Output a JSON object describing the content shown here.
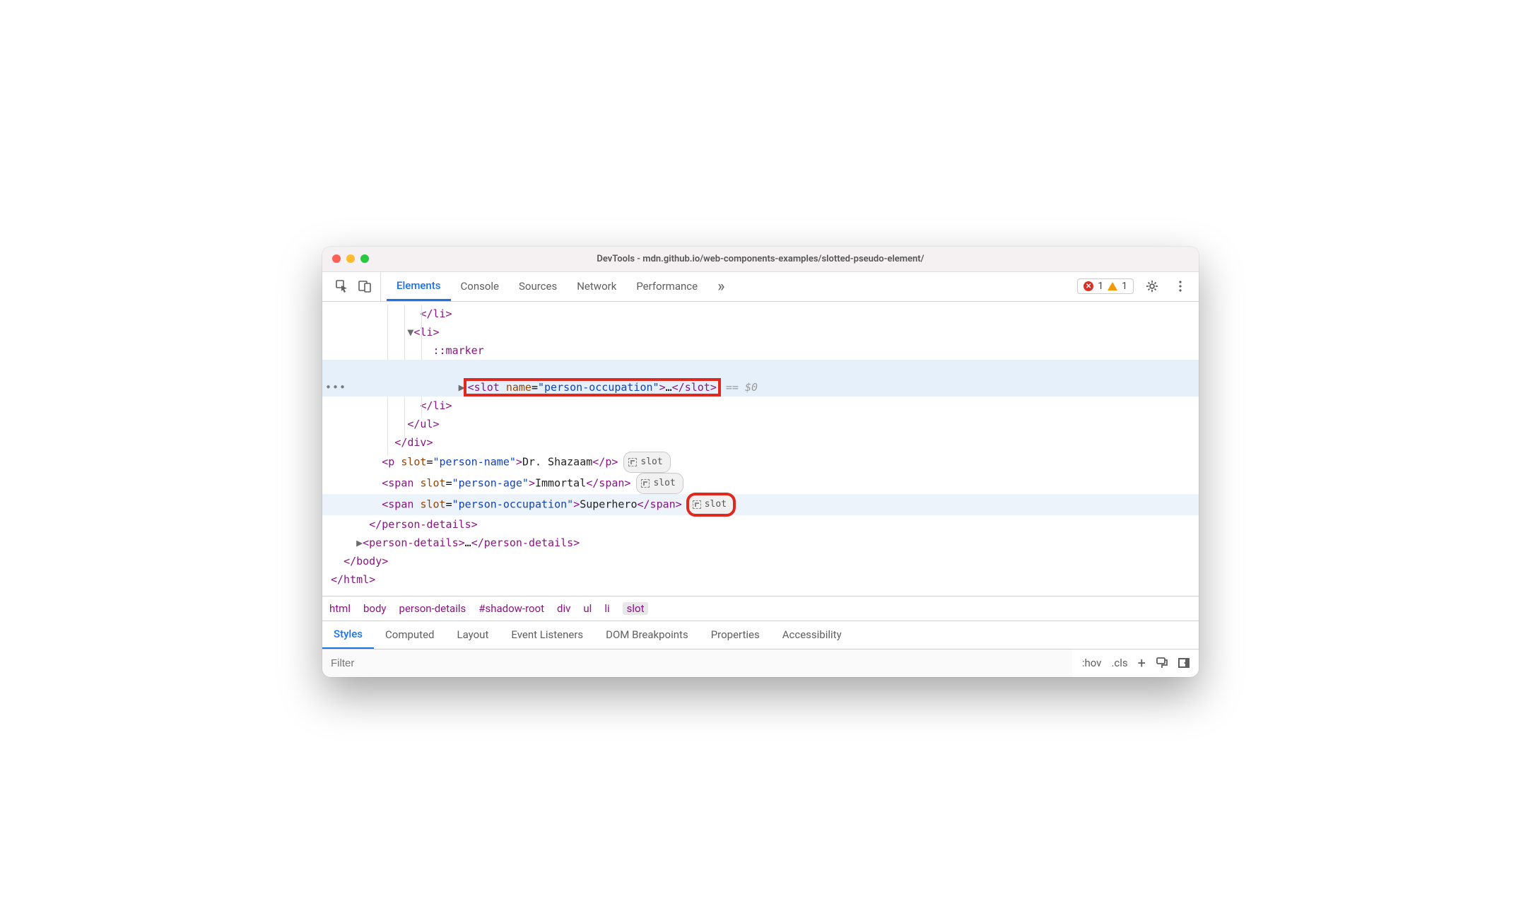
{
  "window": {
    "title": "DevTools - mdn.github.io/web-components-examples/slotted-pseudo-element/"
  },
  "tabs": {
    "elements": "Elements",
    "console": "Console",
    "sources": "Sources",
    "network": "Network",
    "performance": "Performance"
  },
  "issues": {
    "errors": "1",
    "warnings": "1"
  },
  "tree": {
    "close_li": "</li>",
    "open_li": "<li>",
    "marker": "::marker",
    "slot_open_1": "<slot",
    "slot_attr_name": "name",
    "slot_attr_eq": "=",
    "slot_attr_val": "\"person-occupation\"",
    "slot_open_end": ">",
    "slot_ellipsis": "…",
    "slot_close": "</slot>",
    "eq_dollar": " == $0",
    "close_li2": "</li>",
    "close_ul": "</ul>",
    "close_div": "</div>",
    "p_open": "<p",
    "attr_slot": "slot",
    "p_slot_val": "\"person-name\"",
    "p_text": "Dr. Shazaam",
    "p_close": "</p>",
    "span1_val": "\"person-age\"",
    "span1_text": "Immortal",
    "span2_val": "\"person-occupation\"",
    "span2_text": "Superhero",
    "span_open": "<span",
    "span_close": "</span>",
    "close_person": "</person-details>",
    "pd_open": "<person-details>",
    "pd_ell": "…",
    "pd_close": "</person-details>",
    "close_body": "</body>",
    "close_html": "</html>",
    "slot_badge": "slot"
  },
  "breadcrumb": [
    "html",
    "body",
    "person-details",
    "#shadow-root",
    "div",
    "ul",
    "li",
    "slot"
  ],
  "styles_tabs": [
    "Styles",
    "Computed",
    "Layout",
    "Event Listeners",
    "DOM Breakpoints",
    "Properties",
    "Accessibility"
  ],
  "filter": {
    "placeholder": "Filter",
    "hov": ":hov",
    "cls": ".cls"
  }
}
